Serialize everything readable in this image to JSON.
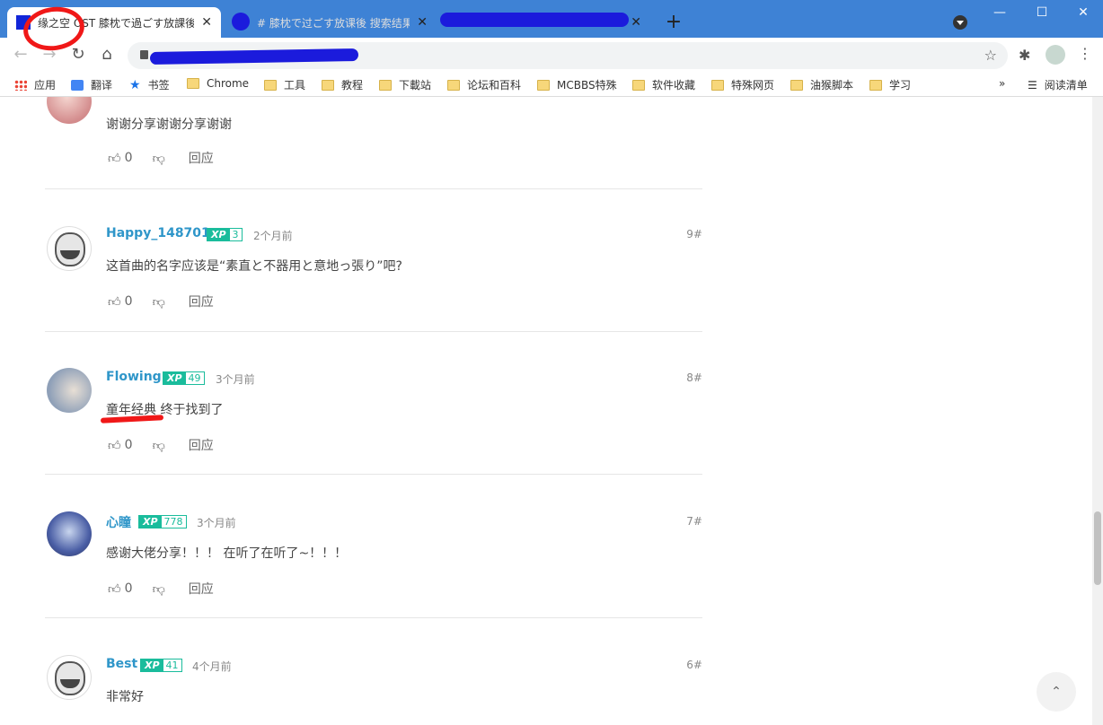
{
  "browser": {
    "tabs": [
      {
        "title": "缘之空 OST 膝枕で過ごす放課後",
        "close": "✕"
      },
      {
        "title": "# 膝枕で过ごす放课後 搜索结果",
        "close": "✕"
      },
      {
        "title": "",
        "close": "✕"
      }
    ],
    "new_tab": "+",
    "window_controls": {
      "minimize": "—",
      "maximize": "☐",
      "close": "✕"
    },
    "nav": {
      "back": "←",
      "forward": "→",
      "reload": "↻",
      "home": "⌂"
    },
    "address_star": "☆",
    "extensions_icon": "✱",
    "menu": "⋮"
  },
  "bookmarks": {
    "items": [
      {
        "label": "应用",
        "icon": "apps-icon"
      },
      {
        "label": "翻译",
        "icon": "translate-icon"
      },
      {
        "label": "书签",
        "icon": "star-icon"
      },
      {
        "label": "Chrome",
        "icon": "folder-icon"
      },
      {
        "label": "工具",
        "icon": "folder-icon"
      },
      {
        "label": "教程",
        "icon": "folder-icon"
      },
      {
        "label": "下載站",
        "icon": "folder-icon"
      },
      {
        "label": "论坛和百科",
        "icon": "folder-icon"
      },
      {
        "label": "MCBBS特殊",
        "icon": "folder-icon"
      },
      {
        "label": "软件收藏",
        "icon": "folder-icon"
      },
      {
        "label": "特殊网页",
        "icon": "folder-icon"
      },
      {
        "label": "油猴脚本",
        "icon": "folder-icon"
      },
      {
        "label": "学习",
        "icon": "folder-icon"
      }
    ],
    "more": "»",
    "reading_list": "阅读清单"
  },
  "comments": [
    {
      "user": "",
      "xp_label": "",
      "xp": "",
      "time": "",
      "floor": "",
      "text": "谢谢分享谢谢分享谢谢",
      "likes": "0",
      "reply": "回应"
    },
    {
      "user": "Happy_148701",
      "xp_label": "XP",
      "xp": "3",
      "time": "2个月前",
      "floor": "9#",
      "text": "这首曲的名字应该是“素直と不器用と意地っ張り”吧?",
      "likes": "0",
      "reply": "回应"
    },
    {
      "user": "Flowing",
      "xp_label": "XP",
      "xp": "49",
      "time": "3个月前",
      "floor": "8#",
      "text": "童年经典 终于找到了",
      "likes": "0",
      "reply": "回应"
    },
    {
      "user": "心瞳",
      "xp_label": "XP",
      "xp": "778",
      "time": "3个月前",
      "floor": "7#",
      "text": "感谢大佬分享！！！ 在听了在听了~！！！",
      "likes": "0",
      "reply": "回应"
    },
    {
      "user": "Best",
      "xp_label": "XP",
      "xp": "41",
      "time": "4个月前",
      "floor": "6#",
      "text": "非常好",
      "likes": "",
      "reply": ""
    }
  ],
  "icons": {
    "like": "👍︎",
    "dislike": "👎︎",
    "back_to_top": "⌃"
  }
}
